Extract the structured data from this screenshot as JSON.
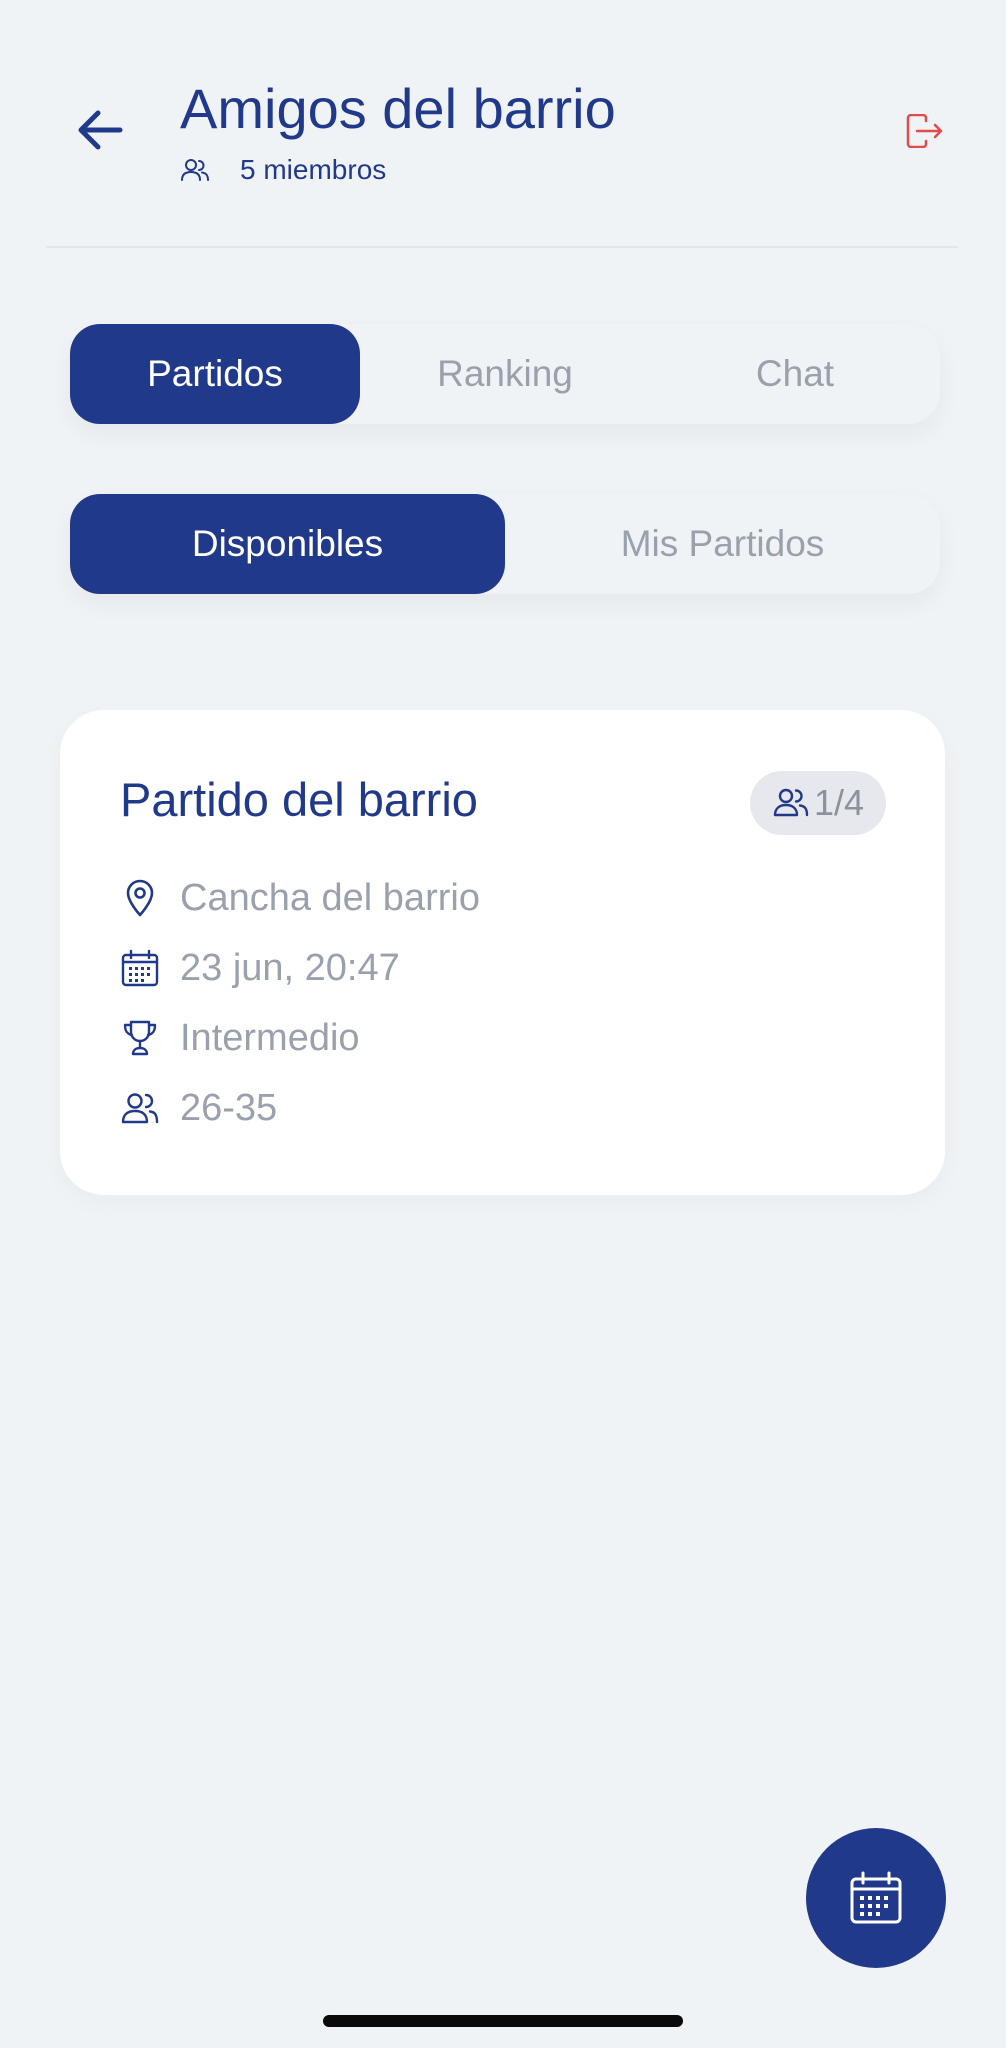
{
  "header": {
    "title": "Amigos del barrio",
    "members_text": "5 miembros",
    "back_icon": "arrow-left-icon",
    "exit_icon": "logout-icon",
    "exit_color": "#e24b4b"
  },
  "tabs": {
    "items": [
      {
        "label": "Partidos",
        "active": true
      },
      {
        "label": "Ranking",
        "active": false
      },
      {
        "label": "Chat",
        "active": false
      }
    ]
  },
  "subtabs": {
    "items": [
      {
        "label": "Disponibles",
        "active": true
      },
      {
        "label": "Mis Partidos",
        "active": false
      }
    ]
  },
  "matches": [
    {
      "title": "Partido del barrio",
      "players": "1/4",
      "location": "Cancha del barrio",
      "datetime": "23 jun, 20:47",
      "level": "Intermedio",
      "age_range": "26-35"
    }
  ],
  "fab": {
    "icon": "calendar-icon"
  },
  "colors": {
    "primary": "#21398a",
    "background": "#f0f3f5",
    "muted_text": "#9aa1ac",
    "card": "#ffffff",
    "danger": "#e24b4b"
  }
}
